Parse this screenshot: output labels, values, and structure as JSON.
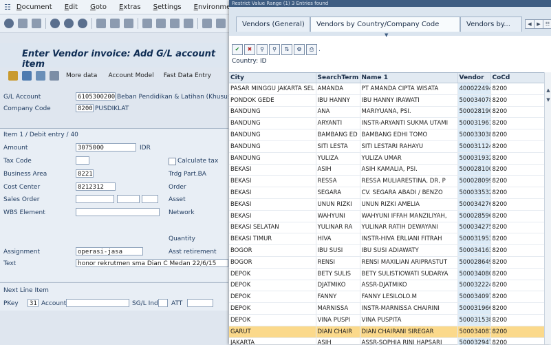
{
  "menubar": {
    "items": [
      "Document",
      "Edit",
      "Goto",
      "Extras",
      "Settings",
      "Environment"
    ]
  },
  "main": {
    "title": "Enter Vendor invoice: Add G/L account item",
    "app_toolbar": {
      "more_data": "More data",
      "account_model": "Account Model",
      "fast_data_entry": "Fast Data Entry"
    },
    "gl_account_label": "G/L Account",
    "gl_account_value": "6105300200",
    "gl_account_desc": "Beban Pendidikan & Latihan (Khusus d",
    "company_code_label": "Company Code",
    "company_code_value": "8200",
    "company_code_desc": "PUSDIKLAT",
    "item_header": "Item 1 / Debit entry / 40",
    "amount_label": "Amount",
    "amount_value": "3075000",
    "currency": "IDR",
    "tax_code_label": "Tax Code",
    "calculate_tax_label": "Calculate tax",
    "business_area_label": "Business Area",
    "business_area_value": "8221",
    "trdg_part_label": "Trdg Part.BA",
    "cost_center_label": "Cost Center",
    "cost_center_value": "8212312",
    "order_label": "Order",
    "sales_order_label": "Sales Order",
    "asset_label": "Asset",
    "wbs_label": "WBS Element",
    "network_label": "Network",
    "quantity_label": "Quantity",
    "assignment_label": "Assignment",
    "assignment_value": "operasi-jasa",
    "asst_retirement_label": "Asst retirement",
    "text_label": "Text",
    "text_value": "honor rekrutmen sma Dian C Medan 22/6/15",
    "next_line_header": "Next Line Item",
    "pkey_label": "PKey",
    "pkey_value": "31",
    "account_label": "Account",
    "sgl_ind_label": "SG/L Ind.",
    "att_label": "ATT"
  },
  "popup": {
    "title": "Restrict Value Range (1) 3 Entries found",
    "tabs": [
      "Vendors (General)",
      "Vendors by Country/Company Code",
      "Vendors by..."
    ],
    "country_label": "Country: ID",
    "columns": [
      "City",
      "SearchTerm",
      "Name 1",
      "Vendor",
      "CoCd"
    ],
    "rows": [
      [
        "PASAR MINGGU JAKARTA SEL",
        "AMANDA",
        "PT AMANDA CIPTA WISATA",
        "400022494",
        "8200"
      ],
      [
        "PONDOK GEDE",
        "IBU HANNY",
        "IBU HANNY IRAWATI",
        "500034078",
        "8200"
      ],
      [
        "BANDUNG",
        "ANA",
        "MARIYUANA, PSI.",
        "500028190",
        "8200"
      ],
      [
        "BANDUNG",
        "ARYANTI",
        "INSTR-ARYANTI SUKMA UTAMI",
        "500031961",
        "8200"
      ],
      [
        "BANDUNG",
        "BAMBANG ED",
        "BAMBANG EDHI TOMO",
        "500033038",
        "8200"
      ],
      [
        "BANDUNG",
        "SITI LESTA",
        "SITI LESTARI RAHAYU",
        "500031124",
        "8200"
      ],
      [
        "BANDUNG",
        "YULIZA",
        "YULIZA UMAR",
        "500031932",
        "8200"
      ],
      [
        "BEKASI",
        "ASIH",
        "ASIH KAMALIA, PSI.",
        "500028100",
        "8200"
      ],
      [
        "BEKASI",
        "RESSA",
        "RESSA MULIARESTINA, DR, P",
        "500028099",
        "8200"
      ],
      [
        "BEKASI",
        "SEGARA",
        "CV. SEGARA ABADI / BENZO",
        "500033532",
        "8200"
      ],
      [
        "BEKASI",
        "UNUN RIZKI",
        "UNUN RIZKI AMELIA",
        "500034276",
        "8200"
      ],
      [
        "BEKASI",
        "WAHYUNI",
        "WAHYUNI IFFAH MANZILIYAH,",
        "500028596",
        "8200"
      ],
      [
        "BEKASI SELATAN",
        "YULINAR RA",
        "YULINAR RATIH DEWAYANI",
        "500034275",
        "8200"
      ],
      [
        "BEKASI TIMUR",
        "HIVA",
        "INSTR-HIVA ERLIANI FITRAH",
        "500031953",
        "8200"
      ],
      [
        "BOGOR",
        "IBU SUSI",
        "IBU SUSI ADIAWATY",
        "500034163",
        "8200"
      ],
      [
        "BOGOR",
        "RENSI",
        "RENSI MAXILIAN ARIPRASTUT",
        "500028649",
        "8200"
      ],
      [
        "DEPOK",
        "BETY SULIS",
        "BETY SULISTIOWATI SUDARYA",
        "500034080",
        "8200"
      ],
      [
        "DEPOK",
        "DJATMIKO",
        "ASSR-DJATMIKO",
        "500032224",
        "8200"
      ],
      [
        "DEPOK",
        "FANNY",
        "FANNY LESILOLO.M",
        "500034097",
        "8200"
      ],
      [
        "DEPOK",
        "MARNISSA",
        "INSTR-MARNISSA CHAIRINI",
        "500031966",
        "8200"
      ],
      [
        "DEPOK",
        "VINA PUSPI",
        "VINA PUSPITA",
        "500031538",
        "8200"
      ],
      [
        "GARUT",
        "DIAN CHAIR",
        "DIAN CHAIRANI SIREGAR",
        "500034081",
        "8200"
      ],
      [
        "JAKARTA",
        "ASIH",
        "ASSR-SOPHIA RINI HAPSARI",
        "500032947",
        "8200"
      ]
    ],
    "selected_row_index": 21
  }
}
